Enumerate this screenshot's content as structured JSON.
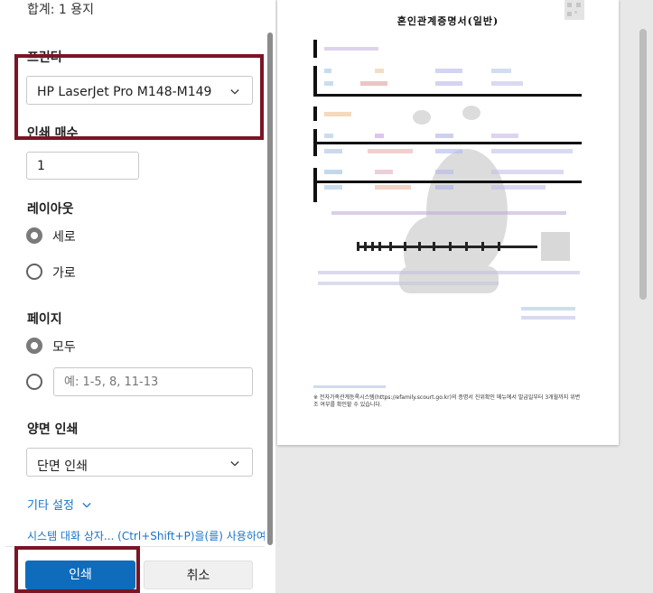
{
  "summary": "합계: 1 용지",
  "printer": {
    "label": "프린터",
    "selected": "HP LaserJet Pro M148-M149"
  },
  "copies": {
    "label": "인쇄 매수",
    "value": "1"
  },
  "layout": {
    "label": "레이아웃",
    "options": [
      "세로",
      "가로"
    ],
    "selected": "세로"
  },
  "pages": {
    "label": "페이지",
    "all_label": "모두",
    "custom_placeholder": "예: 1-5, 8, 11-13",
    "selected": "모두"
  },
  "duplex": {
    "label": "양면 인쇄",
    "selected": "단면 인쇄"
  },
  "more_settings": "기타 설정",
  "system_dialog": "시스템 대화 상자... (Ctrl+Shift+P)을(를) 사용하여",
  "buttons": {
    "print": "인쇄",
    "cancel": "취소"
  },
  "preview": {
    "doc_title": "혼인관계증명서(일반)",
    "footnote": "※ 전자가족관계등록시스템(https://efamily.scourt.go.kr)의 증명서 진위확인 메뉴에서 발급일부터 3개월까지 위변조 여부를 확인할 수 있습니다."
  },
  "colors": {
    "accent": "#0f6cbd",
    "highlight": "#7a1526",
    "link": "#1a73c8"
  }
}
